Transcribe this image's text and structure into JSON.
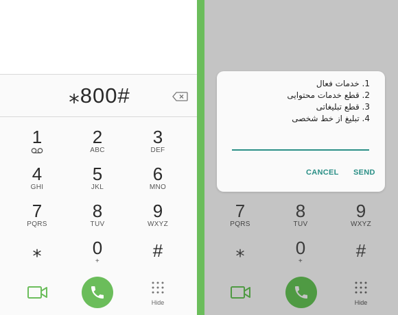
{
  "dialer": {
    "number": "⁎800#",
    "keys": [
      {
        "digit": "1",
        "sub": ""
      },
      {
        "digit": "2",
        "sub": "ABC"
      },
      {
        "digit": "3",
        "sub": "DEF"
      },
      {
        "digit": "4",
        "sub": "GHI"
      },
      {
        "digit": "5",
        "sub": "JKL"
      },
      {
        "digit": "6",
        "sub": "MNO"
      },
      {
        "digit": "7",
        "sub": "PQRS"
      },
      {
        "digit": "8",
        "sub": "TUV"
      },
      {
        "digit": "9",
        "sub": "WXYZ"
      },
      {
        "digit": "⁎",
        "sub": ""
      },
      {
        "digit": "0",
        "sub": "+"
      },
      {
        "digit": "#",
        "sub": ""
      }
    ],
    "hide_label": "Hide",
    "icons": [
      "voicemail-icon",
      "backspace-icon",
      "video-call-icon",
      "phone-icon",
      "keypad-dots-icon"
    ],
    "colors": {
      "call_green": "#6bbd5b",
      "separator_green": "#6bbd5b"
    }
  },
  "ussd_dialog": {
    "lines": [
      "1. خدمات فعال",
      "2. قطع خدمات محتوایی",
      "3. قطع تبلیغاتی",
      "4. تبلیغ از خط شخصی"
    ],
    "cancel_label": "CANCEL",
    "send_label": "SEND",
    "accent_color": "#2a8f86"
  }
}
